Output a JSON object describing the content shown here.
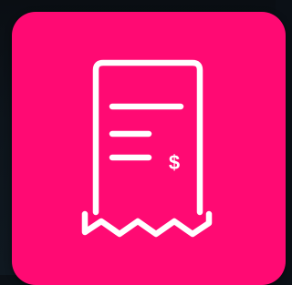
{
  "app_icon": {
    "name": "receipt",
    "icon": "receipt-icon",
    "currency_symbol": "$",
    "colors": {
      "background": "#ff0a73",
      "foreground": "#ffffff",
      "backdrop": "#0b1016"
    }
  }
}
